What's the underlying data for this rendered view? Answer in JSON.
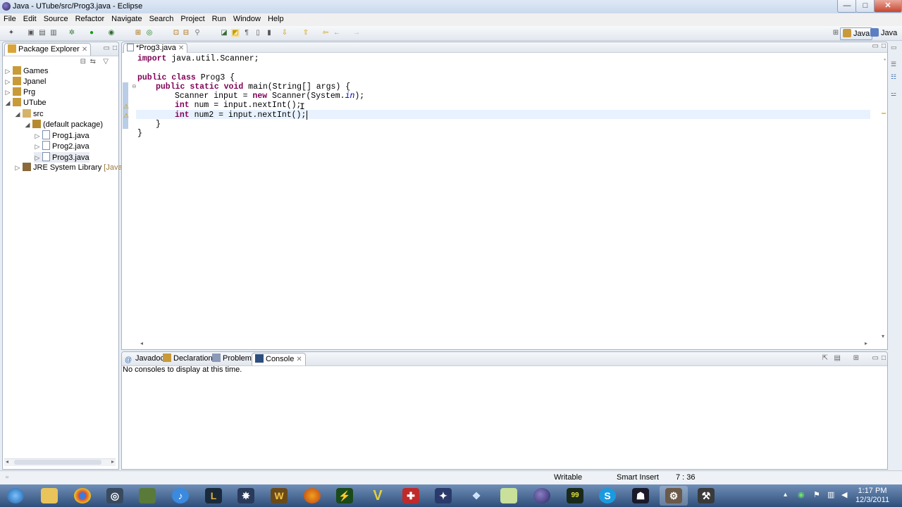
{
  "window": {
    "title": "Java - UTube/src/Prog3.java - Eclipse",
    "min": "—",
    "max": "□",
    "close": "✕"
  },
  "menu": [
    "File",
    "Edit",
    "Source",
    "Refactor",
    "Navigate",
    "Search",
    "Project",
    "Run",
    "Window",
    "Help"
  ],
  "perspectives": {
    "active": "Java",
    "other": "Java"
  },
  "package_explorer": {
    "title": "Package Explorer",
    "items": [
      {
        "label": "Games"
      },
      {
        "label": "Jpanel"
      },
      {
        "label": "Prg"
      },
      {
        "label": "UTube"
      },
      {
        "label": "src"
      },
      {
        "label": "(default package)"
      },
      {
        "label": "Prog1.java"
      },
      {
        "label": "Prog2.java"
      },
      {
        "label": "Prog3.java"
      },
      {
        "label": "JRE System Library",
        "suffix": "[JavaSE-"
      }
    ]
  },
  "editor": {
    "tab": "*Prog3.java",
    "lines": {
      "l1": {
        "kw": "import",
        "rest": " java.util.Scanner;"
      },
      "l3": {
        "kw1": "public",
        "kw2": "class",
        "rest": " Prog3 {"
      },
      "l4": {
        "kw1": "public",
        "kw2": "static",
        "kw3": "void",
        "rest": " main(String[] args) {"
      },
      "l5": {
        "a": "Scanner input = ",
        "kw": "new",
        "b": " Scanner(System.",
        "it": "in",
        "c": ");"
      },
      "l6": {
        "kw": "int",
        "rest": " num = input.nextInt();"
      },
      "l7": {
        "kw": "int",
        "rest": " num2 = input.nextInt();"
      },
      "l8": {
        "text": "}"
      },
      "l9": {
        "text": "}"
      }
    }
  },
  "bottom": {
    "tabs": [
      "Javadoc",
      "Declaration",
      "Problems",
      "Console"
    ],
    "active": "Console",
    "message": "No consoles to display at this time."
  },
  "status": {
    "mode": "Writable",
    "insert": "Smart Insert",
    "position": "7 : 36"
  },
  "taskbar": {
    "apps": [
      "start-orb",
      "explorer",
      "chrome",
      "steam",
      "minecraft",
      "itunes",
      "league",
      "starcraft",
      "warcraft",
      "firefox",
      "winamp",
      "vent",
      "shield",
      "wow-alt",
      "dropbox",
      "notepad",
      "eclipse",
      "trillian",
      "skype",
      "wow2",
      "gear",
      "photoshop"
    ],
    "time": "1:17 PM",
    "date": "12/3/2011"
  }
}
